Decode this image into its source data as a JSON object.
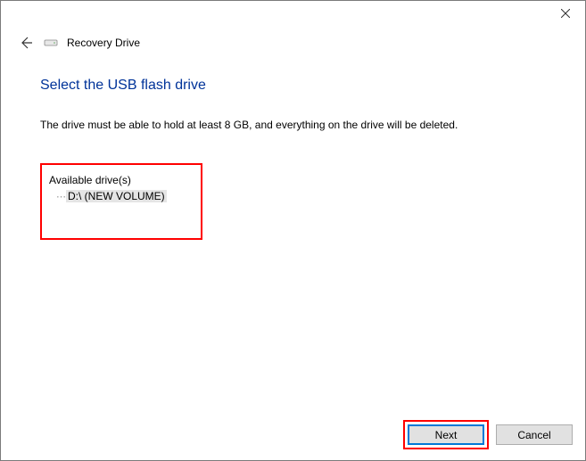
{
  "header": {
    "wizard_name": "Recovery Drive"
  },
  "main": {
    "title": "Select the USB flash drive",
    "instruction": "The drive must be able to hold at least 8 GB, and everything on the drive will be deleted.",
    "drives_label": "Available drive(s)",
    "drives": [
      {
        "label": "D:\\ (NEW VOLUME)"
      }
    ]
  },
  "footer": {
    "next_label": "Next",
    "cancel_label": "Cancel"
  }
}
